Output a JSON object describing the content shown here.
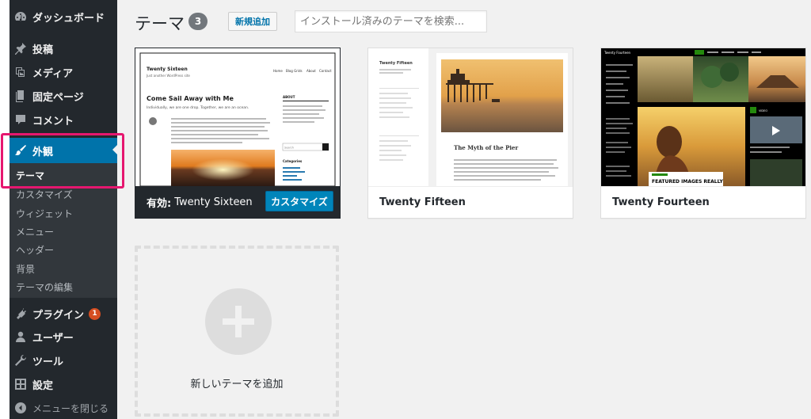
{
  "sidebar": {
    "items": [
      {
        "label": "ダッシュボード",
        "icon": "dashboard-icon"
      },
      {
        "label": "投稿",
        "icon": "pin-icon"
      },
      {
        "label": "メディア",
        "icon": "media-icon"
      },
      {
        "label": "固定ページ",
        "icon": "page-icon"
      },
      {
        "label": "コメント",
        "icon": "comment-icon"
      },
      {
        "label": "外観",
        "icon": "brush-icon"
      },
      {
        "label": "プラグイン",
        "icon": "plugin-icon",
        "badge": "1"
      },
      {
        "label": "ユーザー",
        "icon": "user-icon"
      },
      {
        "label": "ツール",
        "icon": "wrench-icon"
      },
      {
        "label": "設定",
        "icon": "settings-icon"
      },
      {
        "label": "メニューを閉じる",
        "icon": "collapse-icon"
      }
    ],
    "submenu": [
      "テーマ",
      "カスタマイズ",
      "ウィジェット",
      "メニュー",
      "ヘッダー",
      "背景",
      "テーマの編集"
    ]
  },
  "header": {
    "title": "テーマ",
    "count": "3",
    "add_new": "新規追加",
    "search_placeholder": "インストール済みのテーマを検索..."
  },
  "themes": [
    {
      "name": "Twenty Sixteen",
      "active_prefix": "有効:",
      "customize": "カスタマイズ",
      "preview": {
        "site_title": "Twenty Sixteen",
        "tagline": "Just another WordPress site",
        "nav": [
          "Home",
          "Blog Grids",
          "About",
          "Contact"
        ],
        "post_title": "Come Sail Away with Me",
        "excerpt": "Individually, we are one drop. Together, we are an ocean.",
        "widget_search": "Search",
        "widget_title": "Categories"
      }
    },
    {
      "name": "Twenty Fifteen",
      "preview": {
        "site_title": "Twenty Fifteen",
        "post_title": "The Myth of the Pier"
      }
    },
    {
      "name": "Twenty Fourteen",
      "preview": {
        "site_title": "Twenty Fourteen",
        "featured": "FEATURED IMAGES REALLY"
      }
    }
  ],
  "add_theme": {
    "label": "新しいテーマを追加"
  },
  "colors": {
    "sidebar": "#23282d",
    "active": "#0073aa",
    "highlight": "#e6176f",
    "badge": "#d54e21"
  }
}
